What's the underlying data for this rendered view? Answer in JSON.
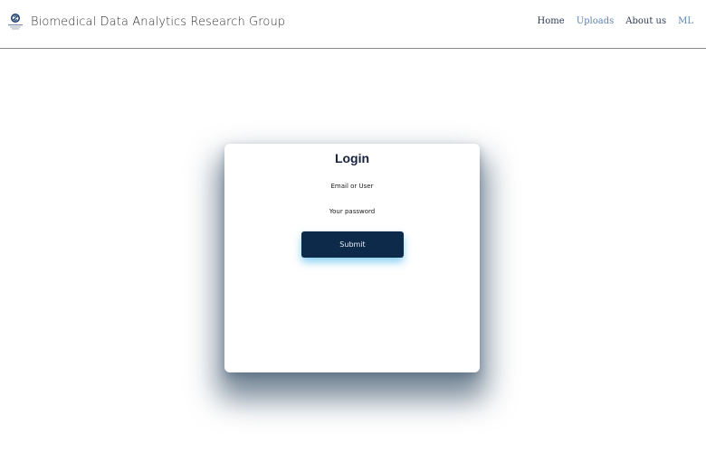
{
  "header": {
    "brand_title": "Biomedical Data Analytics Research Group",
    "logo_icon": "group-logo-icon",
    "nav": [
      {
        "label": "Home"
      },
      {
        "label": "Uploads"
      },
      {
        "label": "About us"
      },
      {
        "label": "ML"
      }
    ],
    "nav_active": "Uploads"
  },
  "login": {
    "title": "Login",
    "email_placeholder": "Email or User",
    "password_placeholder": "Your password",
    "submit_label": "Submit"
  },
  "colors": {
    "button_bg": "#0d2a4a",
    "nav_text": "#2b3a55",
    "nav_active": "#5b84b1",
    "card_shadow": "#0a2846"
  }
}
